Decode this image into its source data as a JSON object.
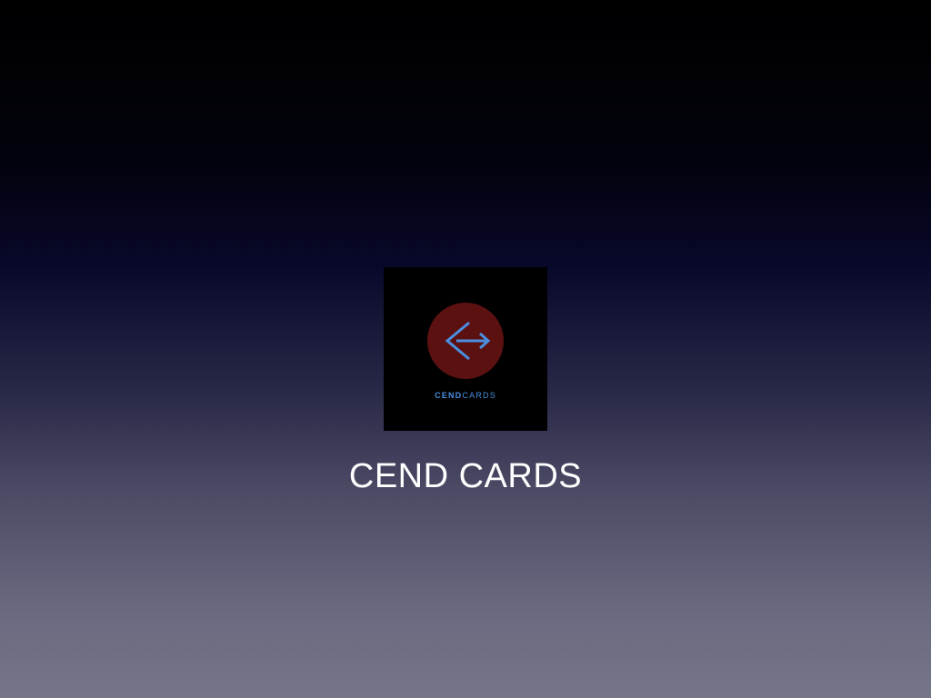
{
  "slide": {
    "title": "CEND CARDS"
  },
  "logo": {
    "icon": "exit-arrow-diamond-icon",
    "wordmark_part1": "CEND",
    "wordmark_part2": "CARDS",
    "colors": {
      "tile": "#000000",
      "circle": "#5c1111",
      "accent": "#4a8fe0"
    }
  },
  "colors": {
    "background_top": "#000000",
    "background_bottom": "#767689",
    "title_text": "#ffffff"
  }
}
